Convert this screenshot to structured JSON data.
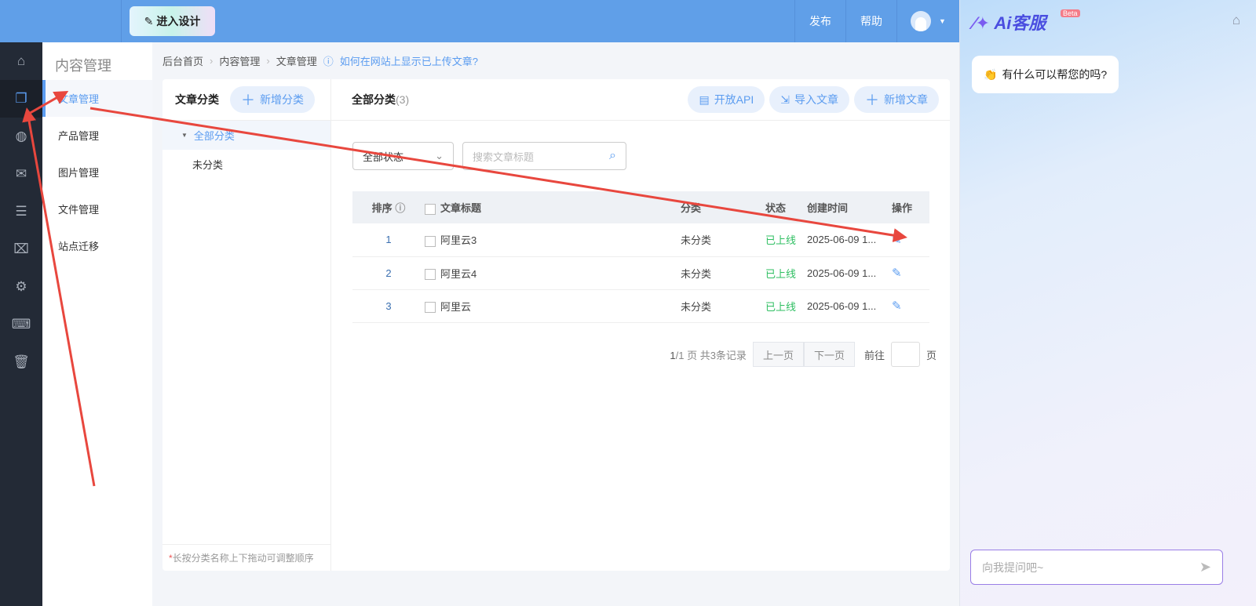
{
  "topbar": {
    "design_label": "进入设计",
    "publish": "发布",
    "help": "帮助"
  },
  "rail": [
    "home-icon",
    "article-icon",
    "planet-icon",
    "chat-icon",
    "list-icon",
    "bag-icon",
    "settings-icon",
    "terminal-icon",
    "trash-icon"
  ],
  "subnav": {
    "title": "内容管理",
    "items": [
      "文章管理",
      "产品管理",
      "图片管理",
      "文件管理",
      "站点迁移"
    ]
  },
  "breadcrumb": {
    "items": [
      "后台首页",
      "内容管理",
      "文章管理"
    ],
    "help": "如何在网站上显示已上传文章?"
  },
  "category": {
    "title": "文章分类",
    "add": "新增分类",
    "items": [
      "全部分类",
      "未分类"
    ],
    "hint_star": "*",
    "hint": "长按分类名称上下拖动可调整顺序"
  },
  "main": {
    "title": "全部分类",
    "count": "(3)",
    "api": "开放API",
    "import": "导入文章",
    "add": "新增文章",
    "status_select": "全部状态",
    "search_placeholder": "搜索文章标题",
    "columns": [
      "排序",
      "文章标题",
      "分类",
      "状态",
      "创建时间",
      "操作"
    ],
    "rows": [
      {
        "order": "1",
        "title": "阿里云3",
        "category": "未分类",
        "status": "已上线",
        "created": "2025-06-09 1..."
      },
      {
        "order": "2",
        "title": "阿里云4",
        "category": "未分类",
        "status": "已上线",
        "created": "2025-06-09 1..."
      },
      {
        "order": "3",
        "title": "阿里云",
        "category": "未分类",
        "status": "已上线",
        "created": "2025-06-09 1..."
      }
    ],
    "pager": {
      "page": "1",
      "pages": "/1 页 共3条记录",
      "prev": "上一页",
      "next": "下一页",
      "goto": "前往",
      "unit": "页"
    }
  },
  "ai": {
    "logo": "Ai客服",
    "beta": "Beta",
    "greeting": "有什么可以帮您的吗?",
    "input_placeholder": "向我提问吧~"
  }
}
